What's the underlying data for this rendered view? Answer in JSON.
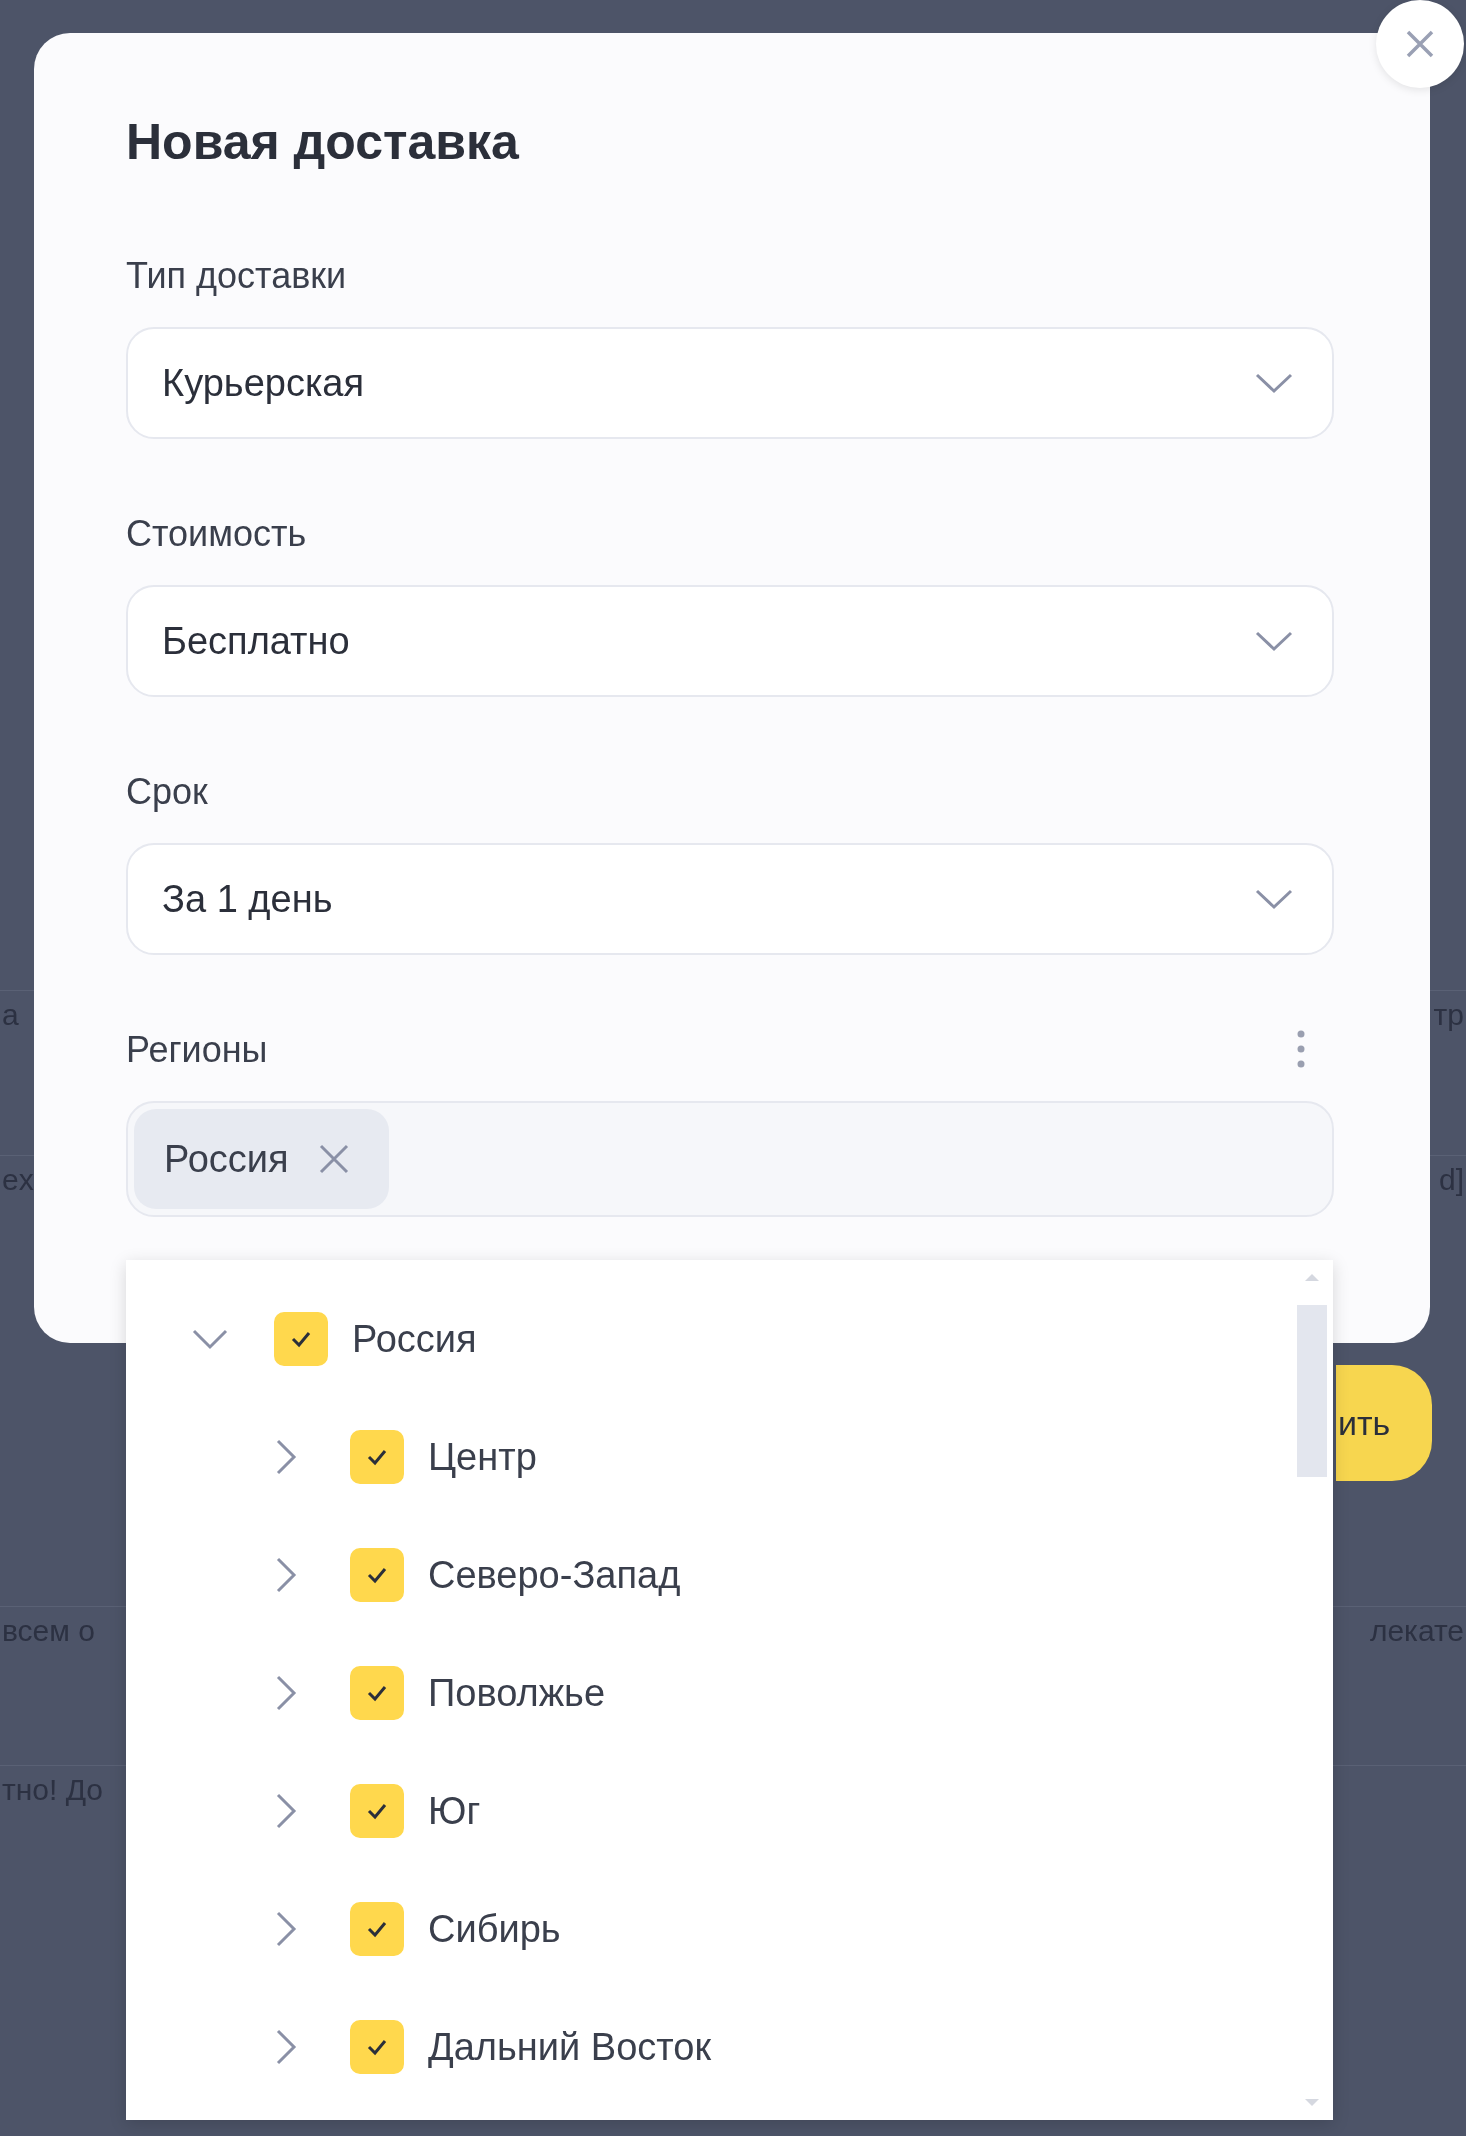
{
  "background": {
    "rows": [
      {
        "left": "а",
        "right": "тр"
      },
      {
        "left": "ex",
        "right": "d]"
      },
      {
        "left": "всем о",
        "right": "лекате"
      },
      {
        "left": "тно! До",
        "right": ""
      }
    ],
    "button": "ить"
  },
  "dialog": {
    "title": "Новая доставка",
    "fields": [
      {
        "label": "Тип доставки",
        "value": "Курьерская"
      },
      {
        "label": "Стоимость",
        "value": "Бесплатно"
      },
      {
        "label": "Срок",
        "value": "За 1 день"
      }
    ],
    "regions": {
      "label": "Регионы",
      "chips": [
        "Россия"
      ],
      "tree": [
        {
          "label": "Россия",
          "checked": true,
          "expanded": true,
          "children": [
            {
              "label": "Центр",
              "checked": true,
              "expanded": false
            },
            {
              "label": "Северо-Запад",
              "checked": true,
              "expanded": false
            },
            {
              "label": "Поволжье",
              "checked": true,
              "expanded": false
            },
            {
              "label": "Юг",
              "checked": true,
              "expanded": false
            },
            {
              "label": "Сибирь",
              "checked": true,
              "expanded": false
            },
            {
              "label": "Дальний Восток",
              "checked": true,
              "expanded": false
            }
          ]
        }
      ]
    }
  }
}
